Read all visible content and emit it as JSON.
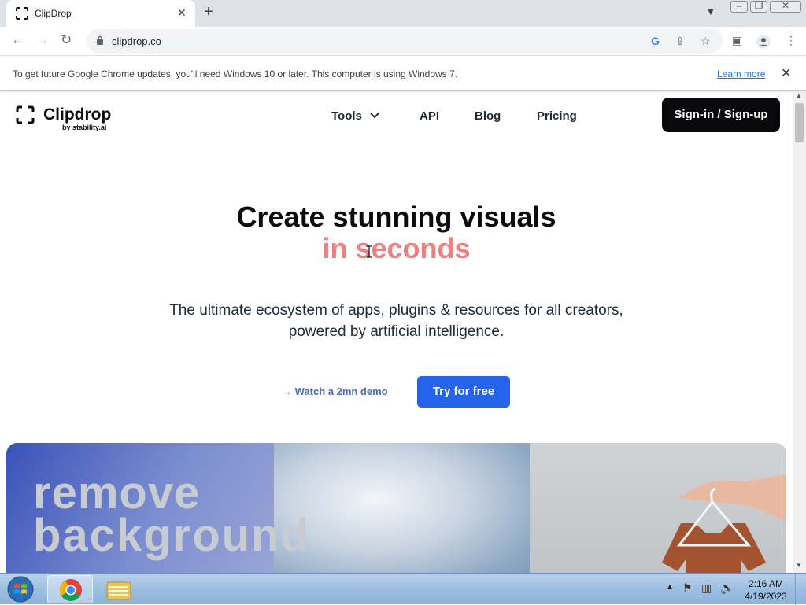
{
  "browser": {
    "tab_title": "ClipDrop",
    "url": "clipdrop.co",
    "infobar_message": "To get future Google Chrome updates, you'll need Windows 10 or later. This computer is using Windows 7.",
    "infobar_link": "Learn more"
  },
  "site": {
    "logo_text": "Clipdrop",
    "logo_sub": "by stability.ai",
    "nav": [
      "Tools",
      "API",
      "Blog",
      "Pricing"
    ],
    "signin_label": "Sign-in / Sign-up",
    "headline_line1": "Create stunning visuals",
    "headline_line2": "in seconds",
    "subhead_line1": "The ultimate ecosystem of apps, plugins & resources for all creators,",
    "subhead_line2": "powered by artificial intelligence.",
    "demo_label": "→ Watch a 2mn demo",
    "try_label": "Try for free",
    "hero_line1": "remove",
    "hero_line2": "background"
  },
  "taskbar": {
    "time": "2:16 AM",
    "date": "4/19/2023"
  },
  "colors": {
    "accent_pink": "#f07f7f",
    "cta_blue": "#2563eb",
    "demo_link": "#4a6bb5"
  }
}
